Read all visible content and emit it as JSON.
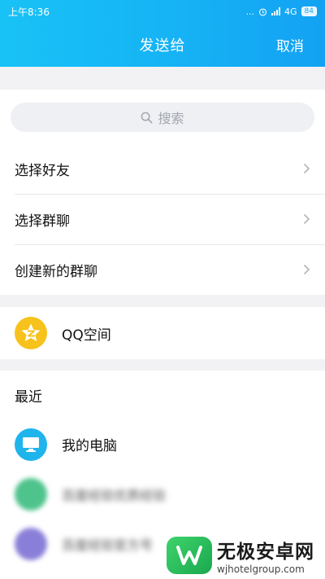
{
  "status_bar": {
    "time": "上午8:36",
    "dots": "...",
    "network": "4G",
    "battery": "84"
  },
  "nav": {
    "title": "发送给",
    "cancel": "取消"
  },
  "search": {
    "placeholder": "搜索"
  },
  "menu": {
    "items": [
      {
        "label": "选择好友"
      },
      {
        "label": "选择群聊"
      },
      {
        "label": "创建新的群聊"
      }
    ]
  },
  "qzone": {
    "label": "QQ空间"
  },
  "recent": {
    "title": "最近",
    "contacts": [
      {
        "name": "我的电脑",
        "icon": "computer-icon"
      },
      {
        "name": "百度经验优质经验",
        "icon": "avatar"
      },
      {
        "name": "百度经验官方号",
        "icon": "avatar"
      }
    ]
  },
  "watermark": {
    "title": "无极安卓网",
    "url": "wjhotelgroup.com"
  },
  "colors": {
    "header_start": "#18c2f6",
    "header_end": "#13a2f3",
    "qzone": "#f7c21b",
    "pc_avatar": "#1fb4ec"
  }
}
